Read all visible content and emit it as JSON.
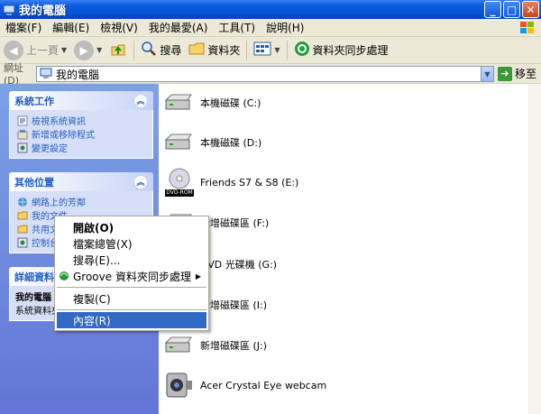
{
  "window": {
    "title": "我的電腦"
  },
  "menu": {
    "items": [
      "檔案(F)",
      "編輯(E)",
      "檢視(V)",
      "我的最愛(A)",
      "工具(T)",
      "說明(H)"
    ]
  },
  "toolbar": {
    "back": "上一頁",
    "search": "搜尋",
    "folders": "資料夾",
    "sync": "資料夾同步處理"
  },
  "address": {
    "label": "網址(D)",
    "value": "我的電腦",
    "go": "移至"
  },
  "left": {
    "system_tasks": {
      "title": "系統工作",
      "items": [
        "檢視系統資訊",
        "新增或移除程式",
        "變更設定"
      ]
    },
    "other_places": {
      "title": "其他位置",
      "items": [
        "網路上的芳鄰",
        "我的文件",
        "共用文件",
        "控制台"
      ]
    },
    "details": {
      "title": "詳細資料",
      "name": "我的電腦",
      "desc": "系統資料夾"
    }
  },
  "drives": [
    {
      "label": "本機磁碟 (C:)",
      "icon": "hard-disk-icon"
    },
    {
      "label": "本機磁碟 (D:)",
      "icon": "hard-disk-icon"
    },
    {
      "label": "Friends S7 & S8 (E:)",
      "icon": "dvd-rom-icon",
      "badge": "DVD-ROM"
    },
    {
      "label": "新增磁碟區 (F:)",
      "icon": "hard-disk-icon"
    },
    {
      "label": "DVD 光碟機 (G:)",
      "icon": "dvd-drive-icon"
    },
    {
      "label": "新增磁碟區 (I:)",
      "icon": "hard-disk-icon"
    },
    {
      "label": "新增磁碟區 (J:)",
      "icon": "hard-disk-icon"
    },
    {
      "label": "Acer Crystal Eye webcam",
      "icon": "webcam-icon"
    }
  ],
  "context_menu": {
    "items": [
      "開啟(O)",
      "檔案總管(X)",
      "搜尋(E)...",
      "Groove 資料夾同步處理",
      "複製(C)",
      "內容(R)"
    ],
    "selected": "內容(R)"
  },
  "colors": {
    "title_blue": "#0554d8",
    "taskpane_blue": "#6375d6",
    "selection": "#316ac5"
  }
}
